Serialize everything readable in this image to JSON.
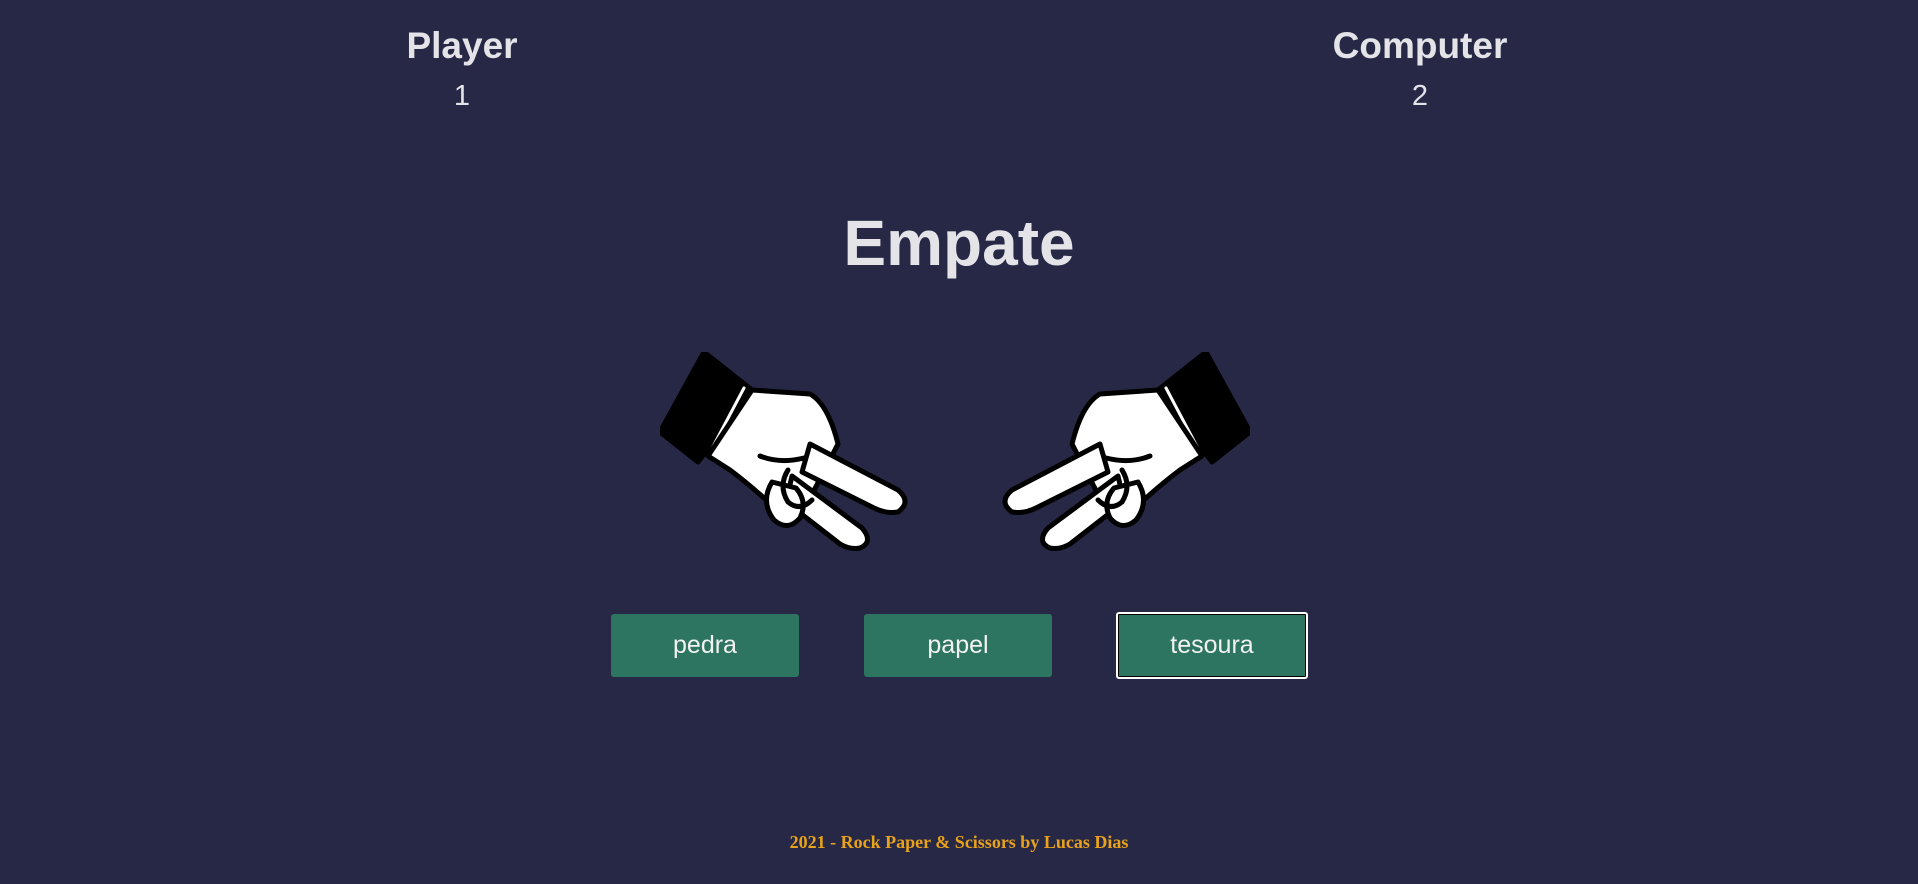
{
  "player": {
    "label": "Player",
    "score": "1"
  },
  "computer": {
    "label": "Computer",
    "score": "2"
  },
  "result": "Empate",
  "hands": {
    "player": "scissors-hand-icon",
    "computer": "scissors-hand-icon"
  },
  "choices": {
    "rock": "pedra",
    "paper": "papel",
    "scissors": "tesoura",
    "selected": "tesoura"
  },
  "footer": "2021 - Rock Paper & Scissors by Lucas Dias",
  "colors": {
    "background": "#272845",
    "button": "#2e7561",
    "text": "#e4e4e8",
    "footer": "#e8a21b"
  }
}
